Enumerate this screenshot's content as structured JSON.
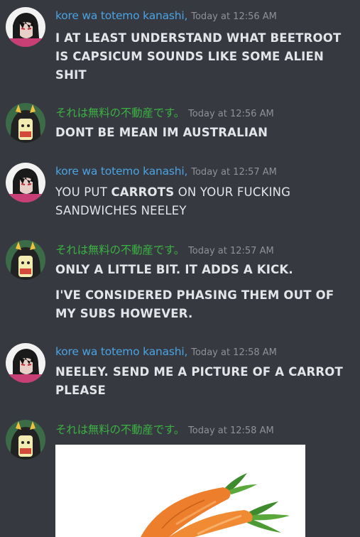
{
  "messages": [
    {
      "author": "kore wa totemo kanashi,",
      "timestamp": "Today at 12:56 AM",
      "lines": [
        "I AT LEAST UNDERSTAND WHAT BEETROOT",
        "IS CAPSICUM SOUNDS LIKE SOME ALIEN",
        "SHIT"
      ]
    },
    {
      "author": "それは無料の不動産です。",
      "timestamp": "Today at 12:56 AM",
      "lines": [
        "DONT BE MEAN IM AUSTRALIAN"
      ]
    },
    {
      "author": "kore wa totemo kanashi,",
      "timestamp": "Today at 12:57 AM",
      "line1_a": "YOU PUT ",
      "line1_b": "CARROTS",
      "line1_c": " ON YOUR FUCKING",
      "line2": "SANDWICHES NEELEY"
    },
    {
      "author": "それは無料の不動産です。",
      "timestamp": "Today at 12:57 AM",
      "lines": [
        "ONLY A LITTLE BIT. IT ADDS A KICK.",
        "I'VE CONSIDERED PHASING THEM OUT OF",
        "MY SUBS HOWEVER."
      ]
    },
    {
      "author": "kore wa totemo kanashi,",
      "timestamp": "Today at 12:58 AM",
      "lines": [
        "NEELEY. SEND ME A PICTURE OF A CARROT",
        "PLEASE"
      ]
    },
    {
      "author": "それは無料の不動産です。",
      "timestamp": "Today at 12:58 AM",
      "attachment": "carrot-photo"
    }
  ],
  "colors": {
    "background": "#36393f",
    "user1": "#4ba3e3",
    "user2": "#3bb143",
    "timestamp": "#8e9297",
    "text": "#e3e5e8"
  }
}
